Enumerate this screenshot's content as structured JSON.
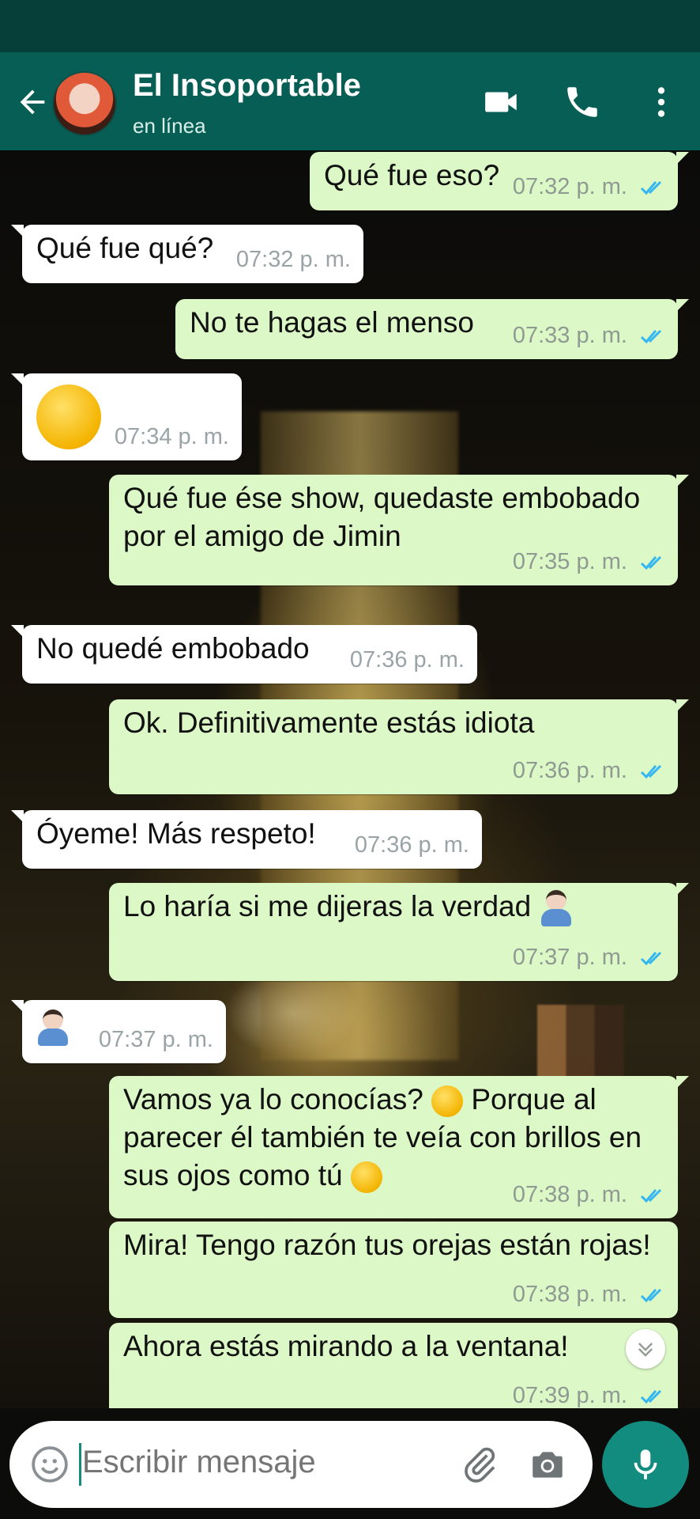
{
  "header": {
    "contact_name": "El Insoportable",
    "status": "en línea"
  },
  "messages": [
    {
      "side": "out",
      "text": "Qué fue eso?",
      "time": "07:32 p. m.",
      "read": true
    },
    {
      "side": "in",
      "text": "Qué fue qué?",
      "time": "07:32 p. m."
    },
    {
      "side": "out",
      "text": "No te hagas el menso",
      "time": "07:33 p. m.",
      "read": true
    },
    {
      "side": "in",
      "emoji": "unamused-face",
      "time": "07:34 p. m."
    },
    {
      "side": "out",
      "text": "Qué fue ése show, quedaste embobado por el amigo de Jimin",
      "time": "07:35 p. m.",
      "read": true
    },
    {
      "side": "in",
      "text": "No quedé embobado",
      "time": "07:36 p. m."
    },
    {
      "side": "out",
      "text": "Ok. Definitivamente estás idiota",
      "time": "07:36 p. m.",
      "read": true
    },
    {
      "side": "in",
      "text": "Óyeme! Más respeto!",
      "time": "07:36 p. m."
    },
    {
      "side": "out",
      "text": "Lo haría si me dijeras la verdad",
      "emoji": "man-shrugging",
      "time": "07:37 p. m.",
      "read": true
    },
    {
      "side": "in",
      "emoji": "man-facepalming",
      "time": "07:37 p. m."
    },
    {
      "side": "out",
      "text_part1": "Vamos ya lo conocías?",
      "emoji1": "smirking-face",
      "text_part2": "Porque al parecer él también te veía con brillos en sus ojos como tú",
      "emoji2": "face-with-hand-over-mouth",
      "time": "07:38 p. m.",
      "read": true
    },
    {
      "side": "out",
      "text": "Mira! Tengo razón tus orejas están rojas!",
      "time": "07:38 p. m.",
      "read": true
    },
    {
      "side": "out",
      "text": "Ahora estás mirando a la ventana!",
      "time": "07:39 p. m.",
      "read": true
    }
  ],
  "composer": {
    "placeholder": "Escribir mensaje"
  },
  "colors": {
    "header": "#075e54",
    "outgoing_bubble": "#dcf8c6",
    "incoming_bubble": "#ffffff",
    "read_tick": "#34b7f1",
    "mic_button": "#128c7e"
  }
}
